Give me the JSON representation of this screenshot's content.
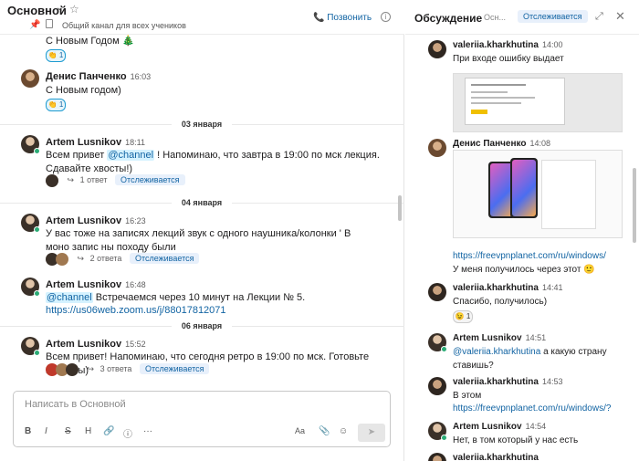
{
  "channel": {
    "title": "Основной",
    "description": "Общий канал для всех учеников",
    "call_label": "Позвонить"
  },
  "messages": [
    {
      "text": "С Новым Годом 🎄",
      "reaction": "👏 1"
    },
    {
      "author": "Денис Панченко",
      "time": "16:03",
      "text": "С Новым годом)",
      "reaction": "👏 1"
    },
    {
      "date": "03 января"
    },
    {
      "author": "Artem Lusnikov",
      "time": "18:11",
      "text_before": "Всем привет ",
      "mention": "@channel",
      "text_after": " ! Напоминаю, что завтра в 19:00 по мск лекция. Сдавайте хвосты!)",
      "replies": "1 ответ",
      "follow": "Отслеживается"
    },
    {
      "date": "04 января"
    },
    {
      "author": "Artem Lusnikov",
      "time": "16:23",
      "text": "У вас тоже на записях лекций звук с одного наушника/колонки  ' В моно запис  ны походу были",
      "replies": "2 ответа",
      "follow": "Отслеживается"
    },
    {
      "author": "Artem Lusnikov",
      "time": "16:48",
      "mention": "@channel",
      "text_after": " Встречаемся через 10 минут на Лекции № 5.",
      "link": "https://us06web.zoom.us/j/88017812071"
    },
    {
      "date": "06 января"
    },
    {
      "author": "Artem Lusnikov",
      "time": "15:52",
      "text": "Всем привет! Напоминаю, что сегодня ретро в 19:00 по мск. Готовьте вопросы)",
      "replies": "3 ответа",
      "follow": "Отслеживается"
    }
  ],
  "composer": {
    "placeholder": "Написать в Основной",
    "toolbar": [
      "B",
      "I",
      "S",
      "H",
      "🔗",
      "ⓘ",
      "···",
      "Aa",
      "📎",
      "☺",
      "➤"
    ]
  },
  "thread": {
    "title": "Обсуждение",
    "subtitle": "Осн...",
    "follow": "Отслеживается",
    "messages": [
      {
        "author": "valeriia.kharkhutina",
        "time": "14:00",
        "text": "При входе ошибку выдает"
      },
      {
        "author": "Денис Панченко",
        "time": "14:08",
        "link": "https://freevpnplanet.com/ru/windows/",
        "text": "У меня получилось через этот 🙂"
      },
      {
        "author": "valeriia.kharkhutina",
        "time": "14:41",
        "text": "Спасибо, получилось)",
        "reaction": "😉 1"
      },
      {
        "author": "Artem Lusnikov",
        "time": "14:51",
        "mention": "@valeriia.kharkhutina",
        "text_after": " а какую страну ставишь?"
      },
      {
        "author": "valeriia.kharkhutina",
        "time": "14:53",
        "text": "В этом",
        "link": "https://freevpnplanet.com/ru/windows/?"
      },
      {
        "author": "Artem Lusnikov",
        "time": "14:54",
        "text": "Нет, в том который у нас есть"
      },
      {
        "author": "valeriia.kharkhutina",
        "time": ""
      }
    ]
  },
  "colors": {
    "link": "#1264a3",
    "online": "#2bac76",
    "follow_bg": "#e8f0fb"
  }
}
